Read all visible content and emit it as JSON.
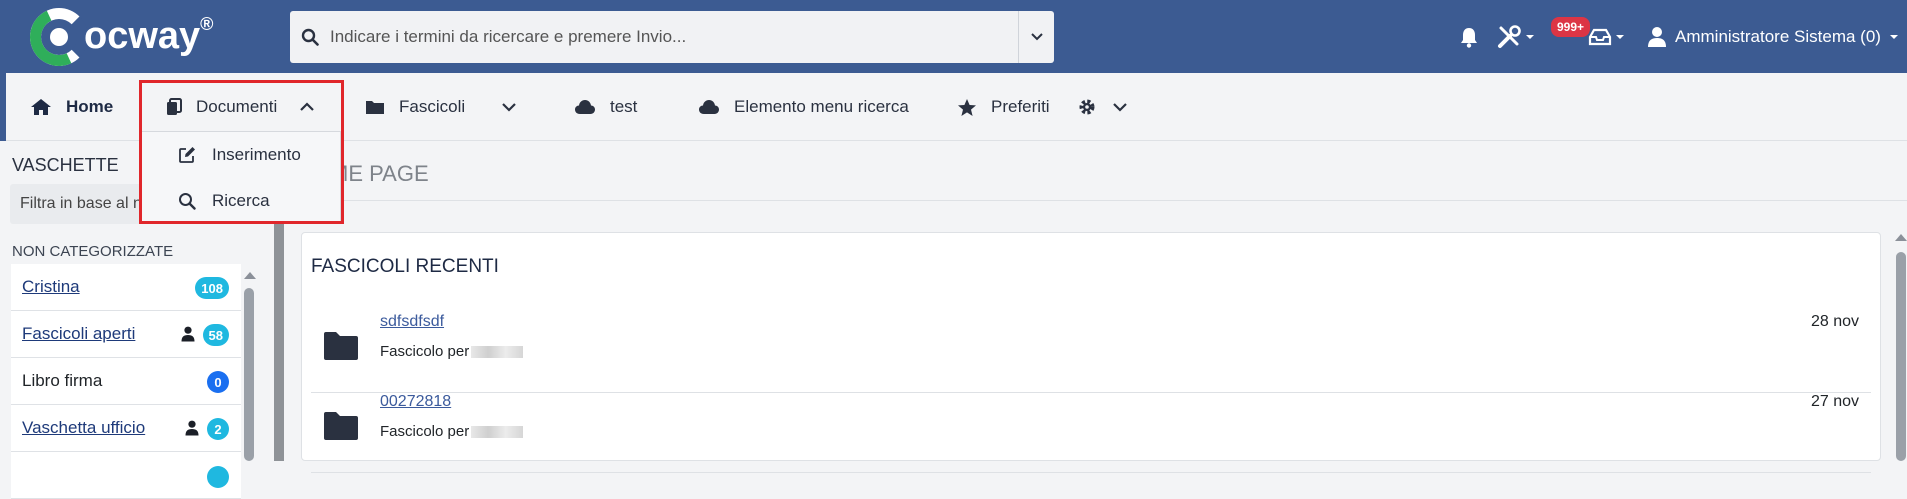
{
  "header": {
    "logo_text": "ocway",
    "logo_reg": "®",
    "search_placeholder": "Indicare i termini da ricercare e premere Invio...",
    "notifications_badge": "999+",
    "user_name": "Amministratore Sistema (0)"
  },
  "nav": {
    "home": "Home",
    "documenti": "Documenti",
    "fascicoli": "Fascicoli",
    "test": "test",
    "elemento_menu_ricerca": "Elemento menu ricerca",
    "preferiti": "Preferiti"
  },
  "documenti_menu": {
    "inserimento": "Inserimento",
    "ricerca": "Ricerca"
  },
  "sidebar": {
    "title": "VASCHETTE",
    "filter_text": "Filtra in base al n",
    "section": "NON CATEGORIZZATE",
    "items": [
      {
        "label": "Cristina",
        "count": "108",
        "color": "#1fb8e0"
      },
      {
        "label": "Fascicoli aperti",
        "count": "58",
        "color": "#1fb8e0"
      },
      {
        "label": "Libro firma",
        "count": "0",
        "color": "#1a6ff0"
      },
      {
        "label": "Vaschetta ufficio",
        "count": "2",
        "color": "#1fb8e0"
      }
    ]
  },
  "main": {
    "page_title": "ME PAGE",
    "card_title": "FASCICOLI RECENTI",
    "fascicoli": [
      {
        "name": "sdfsdfsdf",
        "desc": "Fascicolo per",
        "date": "28 nov"
      },
      {
        "name": "00272818",
        "desc": "Fascicolo per",
        "date": "27 nov"
      }
    ]
  },
  "colors": {
    "header_bg": "#3c5b92",
    "highlight_border": "#e0262b",
    "badge_red": "#dc3545"
  }
}
